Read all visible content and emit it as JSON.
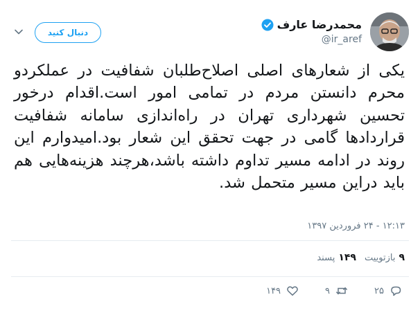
{
  "author": {
    "display_name": "محمدرضا عارف",
    "handle": "@ir_aref",
    "verified": true
  },
  "follow_button_label": "دنبال کنید",
  "tweet": {
    "text": "یکی از شعارهای اصلی اصلاح‌طلبان شفافیت در عملکردو محرم دانستن مردم در تمامی امور است.اقدام درخور تحسین شهرداری تهران در راه‌اندازی سامانه شفافیت قراردادها گامی در جهت تحقق این شعار بود.امیدوارم این روند در ادامه مسیر تداوم داشته باشد،هرچند هزینه‌هایی هم باید دراین مسیر متحمل شد.",
    "timestamp": "۱۲:۱۳ - ۲۴ فروردین ۱۳۹۷"
  },
  "stats": {
    "retweets_count": "۹",
    "retweets_label": "بازتوییت",
    "likes_count": "۱۴۹",
    "likes_label": "پسند"
  },
  "actions": {
    "reply_count": "۲۵",
    "retweet_count": "۹",
    "like_count": "۱۴۹",
    "reply_icon": "reply-icon",
    "retweet_icon": "retweet-icon",
    "like_icon": "heart-icon"
  },
  "colors": {
    "accent": "#1da1f2",
    "secondary_text": "#657786",
    "divider": "#e6ecf0"
  }
}
